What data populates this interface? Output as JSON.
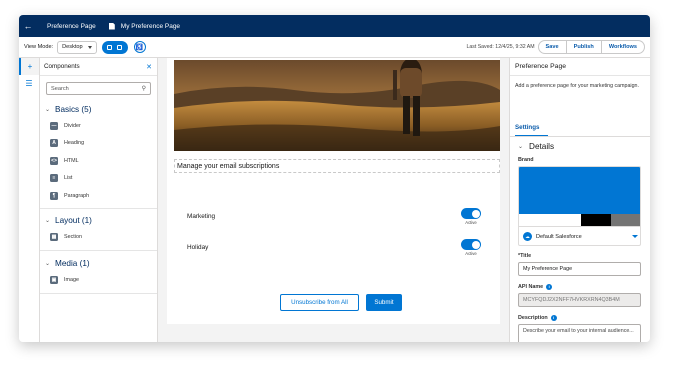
{
  "topbar": {
    "back_icon": "back-arrow-icon",
    "crumb1": "Preference Page",
    "doc_icon": "document-icon",
    "crumb2": "My Preference Page"
  },
  "toolbar": {
    "view_mode_label": "View Mode:",
    "view_mode_value": "Desktop",
    "last_saved": "Last Saved: 12/4/25, 9:32 AM",
    "save_label": "Save",
    "publish_label": "Publish",
    "workflows_label": "Workflows"
  },
  "rail": {
    "items": [
      "add-icon",
      "list-icon"
    ]
  },
  "components": {
    "title": "Components",
    "close_icon": "close-icon",
    "search_placeholder": "Search",
    "groups": [
      {
        "title": "Basics (5)",
        "items": [
          {
            "label": "Divider",
            "icon": "divider-icon",
            "glyph": "—"
          },
          {
            "label": "Heading",
            "icon": "heading-icon",
            "glyph": "A"
          },
          {
            "label": "HTML",
            "icon": "html-icon",
            "glyph": "<>"
          },
          {
            "label": "List",
            "icon": "list-icon",
            "glyph": "≡"
          },
          {
            "label": "Paragraph",
            "icon": "paragraph-icon",
            "glyph": "¶"
          }
        ]
      },
      {
        "title": "Layout (1)",
        "items": [
          {
            "label": "Section",
            "icon": "section-icon",
            "glyph": "▦"
          }
        ]
      },
      {
        "title": "Media (1)",
        "items": [
          {
            "label": "Image",
            "icon": "image-icon",
            "glyph": "▣"
          }
        ]
      }
    ]
  },
  "canvas": {
    "heading": "Manage your email subscriptions",
    "subscriptions": [
      {
        "name": "Marketing",
        "status": "Active",
        "on": true
      },
      {
        "name": "Holiday",
        "status": "Active",
        "on": true
      }
    ],
    "unsubscribe_label": "Unsubscribe from All",
    "submit_label": "Submit"
  },
  "properties": {
    "title": "Preference Page",
    "description": "Add a preference page for your marketing campaign.",
    "tab": "Settings",
    "section": "Details",
    "brand_label": "Brand",
    "brand_value": "Default Salesforce",
    "brand_colors": [
      "#0176d3",
      "#ffffff",
      "#000000",
      "#747474"
    ],
    "title_label": "*Title",
    "title_value": "My Preference Page",
    "api_label": "API Name",
    "api_value": "MCYFQDJ2X2NFF7HVKRXRN4Q3B4M",
    "desc_label": "Description",
    "desc_placeholder": "Describe your email to your internal audience..."
  },
  "colors": {
    "header": "#032d60",
    "accent": "#0176d3"
  }
}
